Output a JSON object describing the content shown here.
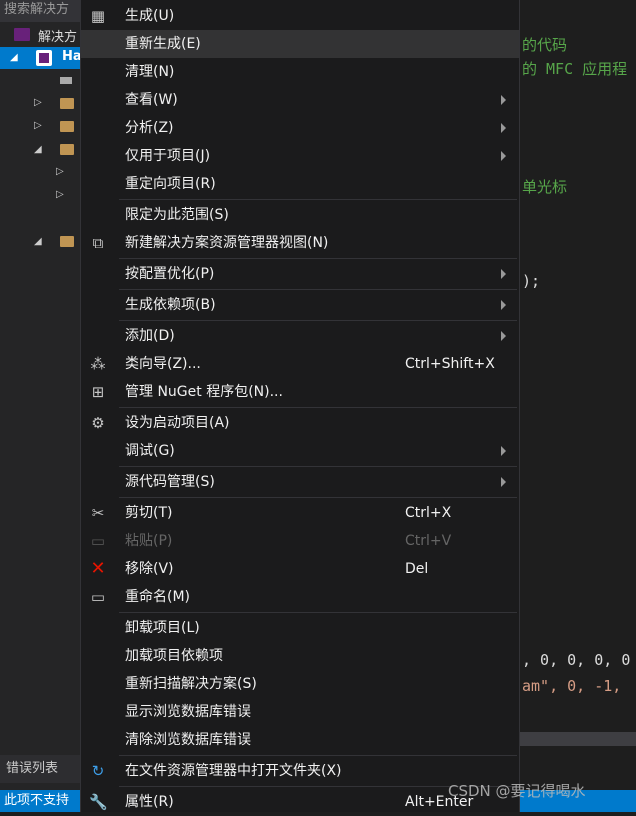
{
  "solution_explorer": {
    "search_placeholder": "搜索解决方",
    "solution_label": "解决方",
    "project_label": "Ha",
    "error_list_tab": "错误列表"
  },
  "status_bar": {
    "text": "此项不支持"
  },
  "editor": {
    "lines": [
      {
        "text": "的代码",
        "color": "#57a64a"
      },
      {
        "text": "的 MFC 应用程",
        "color": "#57a64a"
      },
      {
        "text": "单光标",
        "color": "#57a64a"
      },
      {
        "text": ");",
        "color": "#dcdcdc"
      },
      {
        "text": ", 0, 0, 0, 0",
        "color": "#dcdcdc"
      },
      {
        "text": "am\", 0, -1,",
        "color": "#d69d85"
      }
    ]
  },
  "context_menu": {
    "items": [
      {
        "label": "生成(U)",
        "icon": "build-icon"
      },
      {
        "label": "重新生成(E)",
        "highlighted": true
      },
      {
        "label": "清理(N)"
      },
      {
        "label": "查看(W)",
        "submenu": true
      },
      {
        "label": "分析(Z)",
        "submenu": true
      },
      {
        "label": "仅用于项目(J)",
        "submenu": true
      },
      {
        "label": "重定向项目(R)"
      },
      {
        "label": "限定为此范围(S)"
      },
      {
        "label": "新建解决方案资源管理器视图(N)",
        "icon": "new-view-icon"
      },
      {
        "label": "按配置优化(P)",
        "submenu": true
      },
      {
        "label": "生成依赖项(B)",
        "submenu": true
      },
      {
        "label": "添加(D)",
        "submenu": true
      },
      {
        "label": "类向导(Z)...",
        "shortcut": "Ctrl+Shift+X",
        "icon": "class-wizard-icon"
      },
      {
        "label": "管理 NuGet 程序包(N)...",
        "icon": "nuget-package-icon"
      },
      {
        "label": "设为启动项目(A)",
        "icon": "gear-icon"
      },
      {
        "label": "调试(G)",
        "submenu": true
      },
      {
        "label": "源代码管理(S)",
        "submenu": true
      },
      {
        "label": "剪切(T)",
        "shortcut": "Ctrl+X",
        "icon": "scissors-icon"
      },
      {
        "label": "粘贴(P)",
        "shortcut": "Ctrl+V",
        "icon": "paste-icon",
        "disabled": true
      },
      {
        "label": "移除(V)",
        "shortcut": "Del",
        "icon": "remove-icon"
      },
      {
        "label": "重命名(M)",
        "icon": "rename-icon"
      },
      {
        "label": "卸载项目(L)"
      },
      {
        "label": "加载项目依赖项"
      },
      {
        "label": "重新扫描解决方案(S)"
      },
      {
        "label": "显示浏览数据库错误"
      },
      {
        "label": "清除浏览数据库错误"
      },
      {
        "label": "在文件资源管理器中打开文件夹(X)",
        "icon": "refresh-arrow-icon"
      },
      {
        "label": "属性(R)",
        "shortcut": "Alt+Enter",
        "icon": "wrench-icon"
      }
    ]
  },
  "watermark": "CSDN @要记得喝水",
  "colors": {
    "accent": "#007acc",
    "menu_bg": "#1b1b1c",
    "highlight": "#333334",
    "remove_icon": "#e51400"
  }
}
